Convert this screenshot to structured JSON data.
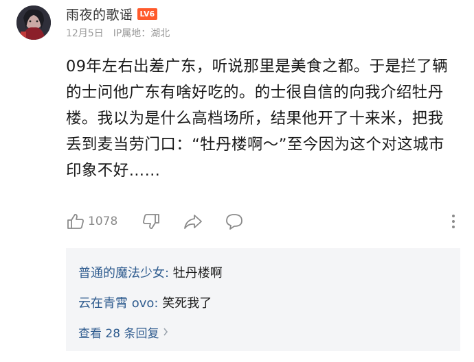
{
  "post": {
    "username": "雨夜的歌谣",
    "level": "LV6",
    "date": "12月5日",
    "ip_location": "IP属地：湖北",
    "content": "09年左右出差广东，听说那里是美食之都。于是拦了辆的士问他广东有啥好吃的。的士很自信的向我介绍牡丹楼。我以为是什么高档场所，结果他开了十来米，把我丢到麦当劳门口：“牡丹楼啊～”至今因为这个对这城市印象不好……",
    "actions": {
      "like_count": "1078",
      "like_icon": "thumbs-up-icon",
      "dislike_icon": "thumbs-down-icon",
      "share_icon": "share-arrow-icon",
      "comment_icon": "comment-bubble-icon",
      "more_icon": "vertical-dots-icon"
    }
  },
  "replies": {
    "items": [
      {
        "author": "普通的魔法少女",
        "separator": ": ",
        "text": "牡丹楼啊"
      },
      {
        "author": "云在青霄 ovo",
        "separator": ": ",
        "text": "笑死我了"
      }
    ],
    "view_more": "查看 28 条回复",
    "view_more_icon": "chevron-right-icon"
  },
  "colors": {
    "level_badge": "#ff5a2b",
    "reply_author": "#2f5c8f",
    "reply_panel_bg": "#f4f5f7",
    "meta_text": "#9a9a9a"
  }
}
